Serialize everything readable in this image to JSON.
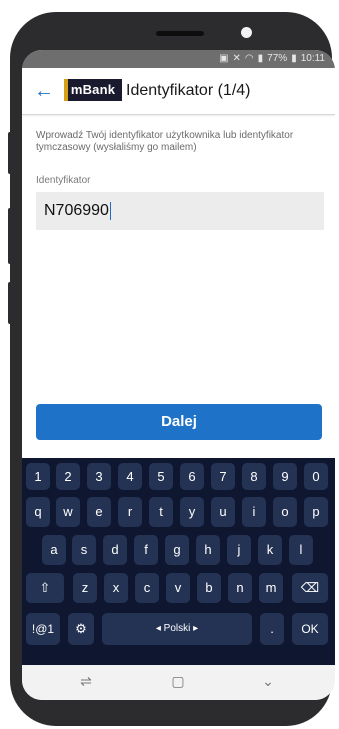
{
  "status": {
    "battery": "77%",
    "time": "10:11"
  },
  "header": {
    "logo": "mBank",
    "title": "Identyfikator (1/4)"
  },
  "form": {
    "description": "Wprowadź Twój identyfikator użytkownika lub identyfikator tymczasowy (wysłaliśmy go mailem)",
    "field_label": "Identyfikator",
    "field_value": "N706990"
  },
  "button": {
    "label": "Dalej"
  },
  "keyboard": {
    "numbers": [
      "1",
      "2",
      "3",
      "4",
      "5",
      "6",
      "7",
      "8",
      "9",
      "0"
    ],
    "row1": [
      "q",
      "w",
      "e",
      "r",
      "t",
      "y",
      "u",
      "i",
      "o",
      "p"
    ],
    "row2": [
      "a",
      "s",
      "d",
      "f",
      "g",
      "h",
      "j",
      "k",
      "l"
    ],
    "row3": [
      "z",
      "x",
      "c",
      "v",
      "b",
      "n",
      "m"
    ],
    "symbols": "!@1",
    "space": "◂ Polski ▸",
    "period": ".",
    "ok": "OK"
  },
  "icons": {
    "back": "arrow-left-icon",
    "shift": "shift-icon",
    "backspace": "backspace-icon",
    "settings": "gear-icon"
  }
}
